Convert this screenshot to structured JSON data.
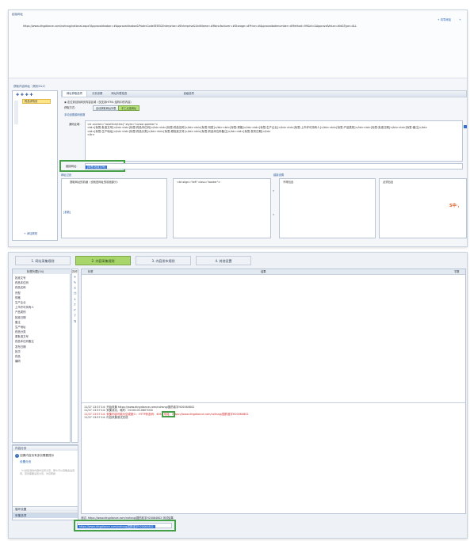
{
  "top": {
    "url_panel_title": "起始网址",
    "url_panel_action": "+ 向导添加",
    "url_panel_action2": "+",
    "url_text": "https://www.dingdiance.com/nohsng/national.aspx?Approvaldnabor=#Approvaldnabor&ProdrcCodeEEEE&Enterprise=#Enterprise&UnitName=#Manufacturer=#Storage=#Price=#Approvalbatenumber=#Method=99&Id=&ApprovalValue=#Id&Type=ALL",
    "rules_title": "获取内容网址（规则1&2）",
    "toolbar_icons": [
      "plus-icon",
      "plus-icon",
      "plus-icon",
      "plus-icon"
    ],
    "list_item": "药品详情页",
    "tabs": [
      "网址获取选项",
      "分页设置",
      "网址列表检查",
      "高级选项"
    ],
    "option_radio": "定位到目标网页内容区域（仅支持HTML 结构中的内容）",
    "get_method_label": "获取方式：",
    "btn_script": "自动获取网址列表",
    "btn_green": "手工点选网址",
    "source_label": "手动设置源码参数",
    "code_label": "源码区域：",
    "code_lines": [
      "<tr onclick=\"rowClick(this)\" style=\"cursor:pointer\">",
      "      <td>[标签:批准文号]</td><td>[标签:药品本位码]</td><td>[标签:药品名称]</td><td>[标签:剂型]</td><td>[标签:规格]</td><td>[标签:生产企业]</td><td>[标签:上市许可持有人]</td><td>[标签:产品类别]</td><td>[标签:批准日期]</td><td>[标签:备注]</td>",
      "<td>[标签:生产地址]</td><td>[标签:药品分类]</td><td>[标签:原批准文号]</td><td>[标签:药品本位码备注]</td><td>[标签:发布日期]</td>",
      "        </tr>"
    ],
    "result_label": "链接网址：",
    "result_value": "[标签:批准文号]",
    "filter_left_title": "网址过滤",
    "filter_right_title": "链接设置",
    "filter_item": "提取网址的前缀（也就是网址的前面部分）",
    "filter_left_inner": "[参数]",
    "filter_mid_text": "<td align=\"left\" class=\"border\">",
    "filter_right_col1": "不得包含",
    "filter_right_col2": "必须包含",
    "arrow_left": "»",
    "arrow_right": "»",
    "add_btn": "+ 添加规则",
    "sogou_icon": "S中·,"
  },
  "bottom": {
    "steps": [
      "1. 网址采集规则",
      "2. 内容采集规则",
      "3. 内容发布规则",
      "4. 其他设置"
    ],
    "active_step": 1,
    "side_header": "标签列表(34)",
    "side_header2": "操作",
    "side_items": [
      "批准文号",
      "药品本位码",
      "药品名称",
      "剂型",
      "规格",
      "生产企业",
      "上市许可持有人",
      "产品类别",
      "批准日期",
      "备注",
      "生产地址",
      "药品分类",
      "原批准文号",
      "药品本位码备注",
      "发布日期",
      "批次",
      "药品",
      "编码"
    ],
    "tool_icons": [
      "plus-icon",
      "pencil-icon",
      "x-icon",
      "copy-icon",
      "down-icon",
      "up-icon",
      "undo-icon",
      "question-icon",
      "sort-icon"
    ],
    "col_label": "标签",
    "col_result": "结果",
    "col_count": "字数",
    "log": [
      {
        "text": "11/27 13:37:14: 开始采集 https://www.dingdiance.com/nohsng/国药准字H20064802",
        "red": false
      },
      {
        "text": "11/27 13:37:14: 采集成功，耗时：00:00:00.0607000",
        "red": false
      },
      {
        "text": "11/27 13:37:14: 采集内容可能为空或缺少：HTTP状态码：404，地址：https://www.dingdiance.com/nohsng/国药准字H20064802",
        "red": true
      },
      {
        "text": "11/27 13:37:14: 内容采集测试完成",
        "red": false
      }
    ],
    "log_highlight": "404",
    "acc_sections": [
      "内容分页",
      "循环设置",
      "采集选项"
    ],
    "acc_active": "采集选项",
    "info_icon_text": "i",
    "info_title": "如果内容页有多页需要提示",
    "info_link": "设置分页",
    "info_desc": "（1)采集到的内容中没有分页，那么可以忽略此设置项，否则需要设置分页，详见帮助",
    "bottom_bar": "测试: https://www.dingdiance.com/nohsng/国药准字H20064802 测试结果",
    "bottom_input": "https://www.dingdiance.com/nohsng/国药准字H20064802",
    "accent_green": "#43a047",
    "step_active_color": "#a8d66a"
  }
}
